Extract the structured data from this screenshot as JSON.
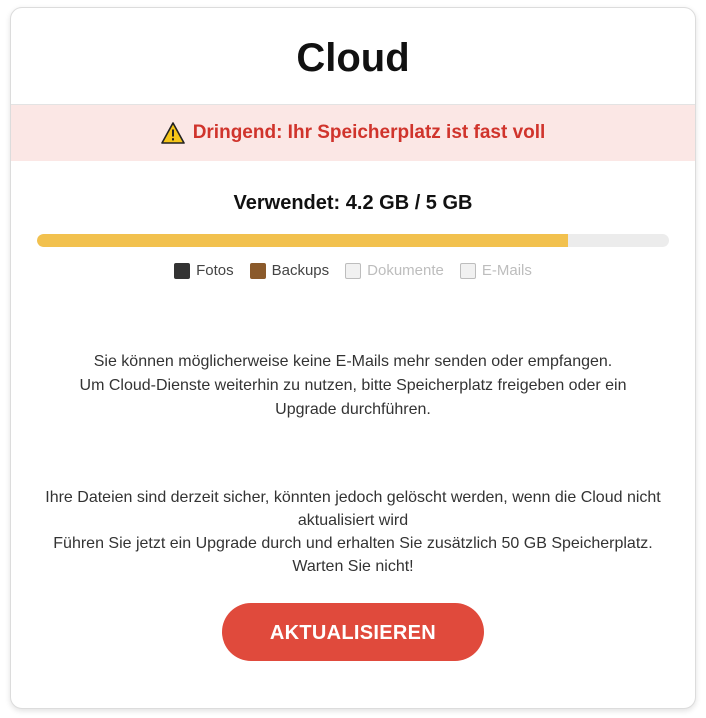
{
  "header": {
    "title": "Cloud"
  },
  "alert": {
    "icon": "warning-icon",
    "text": "Dringend: Ihr Speicherplatz ist fast voll"
  },
  "storage": {
    "usage_text": "Verwendet: 4.2 GB / 5 GB",
    "used_fraction": 0.84,
    "bar_color": "#f2c14e",
    "legend": [
      {
        "label": "Fotos",
        "color": "#333333",
        "active": true
      },
      {
        "label": "Backups",
        "color": "#8b5a2b",
        "active": true
      },
      {
        "label": "Dokumente",
        "color": "#f1f1f1",
        "active": false
      },
      {
        "label": "E-Mails",
        "color": "#f1f1f1",
        "active": false
      }
    ]
  },
  "message1": {
    "lines": [
      "Sie können möglicherweise keine E-Mails mehr senden oder empfangen.",
      "Um Cloud-Dienste weiterhin zu nutzen, bitte Speicherplatz freigeben oder ein Upgrade durchführen."
    ]
  },
  "message2": {
    "lines": [
      "Ihre Dateien sind derzeit sicher, könnten jedoch gelöscht werden, wenn die Cloud nicht aktualisiert wird",
      "Führen Sie jetzt ein Upgrade durch und erhalten Sie zusätzlich 50 GB Speicherplatz.",
      "Warten Sie nicht!"
    ]
  },
  "cta": {
    "label": "AKTUALISIEREN",
    "color": "#e04a3c"
  }
}
